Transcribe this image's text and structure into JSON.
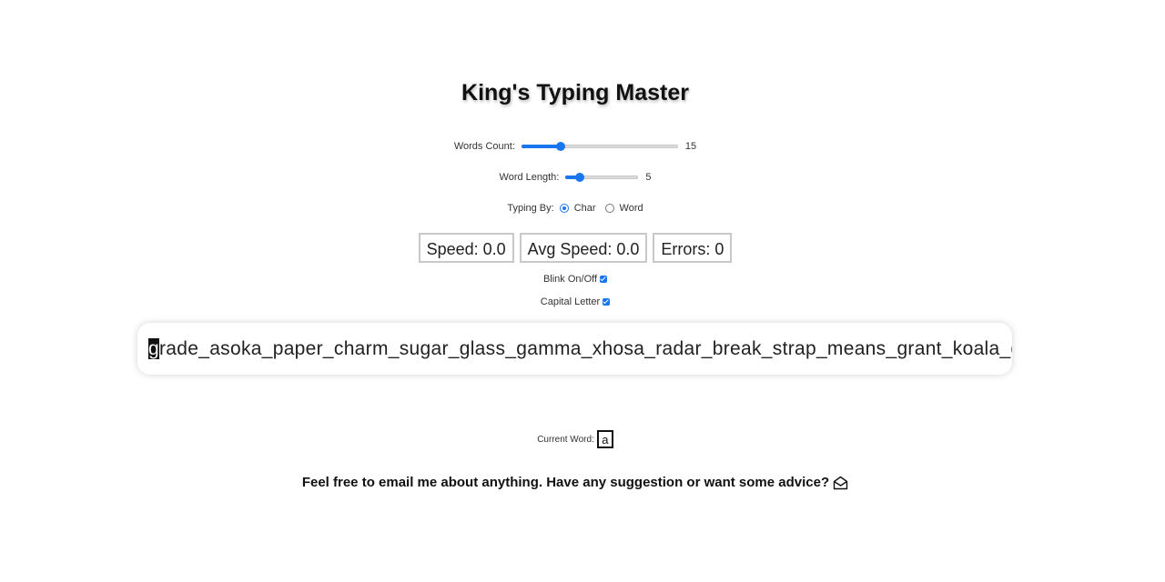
{
  "title": "King's Typing Master",
  "words_count": {
    "label": "Words Count:",
    "value": "15",
    "fraction": 0.25
  },
  "word_length": {
    "label": "Word Length:",
    "value": "5",
    "fraction": 0.2
  },
  "typing_by": {
    "label": "Typing By:",
    "options": [
      "Char",
      "Word"
    ],
    "selected": "Char"
  },
  "stats": {
    "speed": "Speed: 0.0",
    "avg_speed": "Avg Speed: 0.0",
    "errors": "Errors: 0"
  },
  "blink": {
    "label": "Blink On/Off",
    "checked": true
  },
  "capital": {
    "label": "Capital Letter",
    "checked": true
  },
  "typing_text": {
    "cursor_char": "g",
    "rest": "rade_asoka_paper_charm_sugar_glass_gamma_xhosa_radar_break_strap_means_grant_koala_ganga_"
  },
  "current_word": {
    "label": "Current Word:",
    "value": "a"
  },
  "footer": {
    "text": "Feel free to email me about anything. Have any suggestion or want some advice?",
    "icon": "envelope-open-icon"
  },
  "colors": {
    "accent": "#1976f0",
    "border": "#c8c8c8"
  }
}
